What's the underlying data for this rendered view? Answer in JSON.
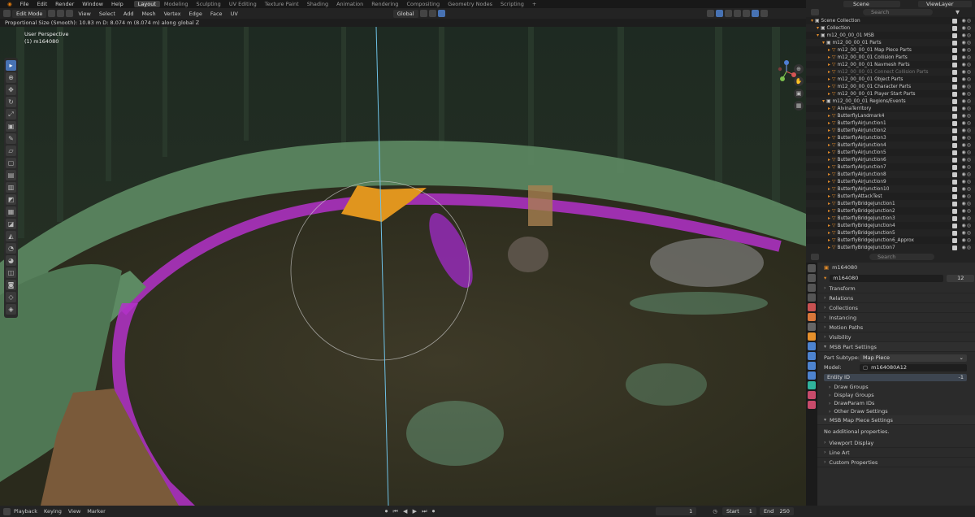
{
  "menu": [
    "File",
    "Edit",
    "Render",
    "Window",
    "Help"
  ],
  "workspaces": [
    "Layout",
    "Modeling",
    "Sculpting",
    "UV Editing",
    "Texture Paint",
    "Shading",
    "Animation",
    "Rendering",
    "Compositing",
    "Geometry Nodes",
    "Scripting"
  ],
  "active_workspace": "Layout",
  "scene": "Scene",
  "view_layer": "ViewLayer",
  "header": {
    "mode": "Edit Mode",
    "items": [
      "View",
      "Select",
      "Add",
      "Mesh",
      "Vertex",
      "Edge",
      "Face",
      "UV"
    ],
    "orientation": "Global"
  },
  "status_line": "Proportional Size (Smooth): 10.83 m   D: 8.074 m (8.074 m) along global Z",
  "viewport": {
    "perspective": "User Perspective",
    "object": "(1) m164080"
  },
  "outliner": {
    "search_placeholder": "Search",
    "rows": [
      {
        "label": "Scene Collection",
        "indent": 0,
        "color": "#ccc"
      },
      {
        "label": "Collection",
        "indent": 1,
        "color": "#ccc"
      },
      {
        "label": "m12_00_00_01 MSB",
        "indent": 1,
        "color": "#ccc"
      },
      {
        "label": "m12_00_00_01 Parts",
        "indent": 2,
        "color": "#ccc"
      },
      {
        "label": "m12_00_00_01 Map Piece Parts",
        "indent": 3,
        "color": "#ccc"
      },
      {
        "label": "m12_00_00_01 Collision Parts",
        "indent": 3,
        "color": "#ccc"
      },
      {
        "label": "m12_00_00_01 Navmesh Parts",
        "indent": 3,
        "color": "#ccc"
      },
      {
        "label": "m12_00_00_01 Connect Collision Parts",
        "indent": 3,
        "color": "#777"
      },
      {
        "label": "m12_00_00_01 Object Parts",
        "indent": 3,
        "color": "#ccc"
      },
      {
        "label": "m12_00_00_01 Character Parts",
        "indent": 3,
        "color": "#ccc"
      },
      {
        "label": "m12_00_00_01 Player Start Parts",
        "indent": 3,
        "color": "#ccc"
      },
      {
        "label": "m12_00_00_01 Regions/Events",
        "indent": 2,
        "color": "#ccc"
      },
      {
        "label": "AlvinaTerritory",
        "indent": 3,
        "color": "#ccc"
      },
      {
        "label": "ButterflyLandmark4",
        "indent": 3,
        "color": "#ccc"
      },
      {
        "label": "ButterflyAirJunction1",
        "indent": 3,
        "color": "#ccc"
      },
      {
        "label": "ButterflyAirJunction2",
        "indent": 3,
        "color": "#ccc"
      },
      {
        "label": "ButterflyAirJunction3",
        "indent": 3,
        "color": "#ccc"
      },
      {
        "label": "ButterflyAirJunction4",
        "indent": 3,
        "color": "#ccc"
      },
      {
        "label": "ButterflyAirJunction5",
        "indent": 3,
        "color": "#ccc"
      },
      {
        "label": "ButterflyAirJunction6",
        "indent": 3,
        "color": "#ccc"
      },
      {
        "label": "ButterflyAirJunction7",
        "indent": 3,
        "color": "#ccc"
      },
      {
        "label": "ButterflyAirJunction8",
        "indent": 3,
        "color": "#ccc"
      },
      {
        "label": "ButterflyAirJunction9",
        "indent": 3,
        "color": "#ccc"
      },
      {
        "label": "ButterflyAirJunction10",
        "indent": 3,
        "color": "#ccc"
      },
      {
        "label": "ButterflyAttackTest",
        "indent": 3,
        "color": "#ccc"
      },
      {
        "label": "ButterflyBridgeJunction1",
        "indent": 3,
        "color": "#ccc"
      },
      {
        "label": "ButterflyBridgeJunction2",
        "indent": 3,
        "color": "#ccc"
      },
      {
        "label": "ButterflyBridgeJunction3",
        "indent": 3,
        "color": "#ccc"
      },
      {
        "label": "ButterflyBridgeJunction4",
        "indent": 3,
        "color": "#ccc"
      },
      {
        "label": "ButterflyBridgeJunction5",
        "indent": 3,
        "color": "#ccc"
      },
      {
        "label": "ButterflyBridgeJunction6_Approx",
        "indent": 3,
        "color": "#ccc"
      },
      {
        "label": "ButterflyBridgeJunction7",
        "indent": 3,
        "color": "#ccc"
      }
    ]
  },
  "properties": {
    "search_placeholder": "Search",
    "object": "m164080",
    "name_field": "m164080",
    "users": "12",
    "panels_top": [
      "Transform",
      "Relations",
      "Collections",
      "Instancing",
      "Motion Paths",
      "Visibility"
    ],
    "msb_part": "MSB Part Settings",
    "part_subtype_label": "Part Subtype:",
    "part_subtype": "Map Piece",
    "model_label": "Model:",
    "model": "m164080A12",
    "entity_label": "Entity ID",
    "entity": "-1",
    "sub_panels": [
      "Draw Groups",
      "Display Groups",
      "DrawParam IDs",
      "Other Draw Settings"
    ],
    "msb_map_piece": "MSB Map Piece Settings",
    "no_props": "No additional properties.",
    "panels_bottom": [
      "Viewport Display",
      "Line Art",
      "Custom Properties"
    ]
  },
  "timeline": {
    "items": [
      "Playback",
      "Keying",
      "View",
      "Marker"
    ],
    "frame": "1",
    "start_label": "Start",
    "start": "1",
    "end_label": "End",
    "end": "250"
  }
}
